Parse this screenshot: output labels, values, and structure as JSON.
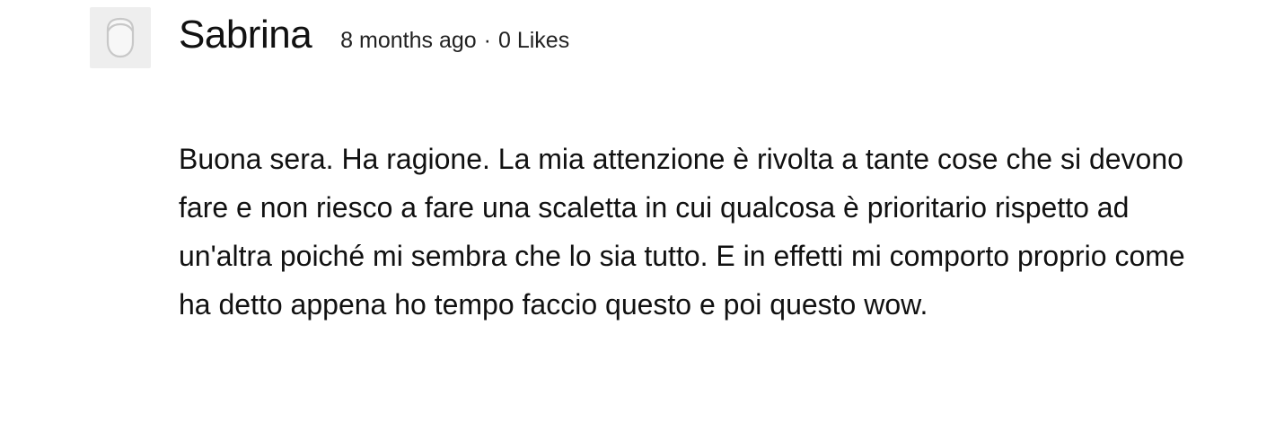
{
  "comment": {
    "avatar_icon": "default-user-avatar-icon",
    "author": "Sabrina",
    "timestamp": "8 months ago",
    "separator": "·",
    "likes": "0 Likes",
    "text": "Buona sera. Ha ragione. La mia attenzione è rivolta a tante cose che si devono fare e non riesco a fare una scaletta in cui qualcosa è prioritario rispetto ad un'altra poiché mi sembra che lo sia tutto. E in effetti mi comporto proprio come ha detto appena ho tempo faccio questo e poi questo wow."
  },
  "colors": {
    "avatar_background": "#eeeeee",
    "avatar_glyph": "#cccccc",
    "text": "#111111"
  }
}
